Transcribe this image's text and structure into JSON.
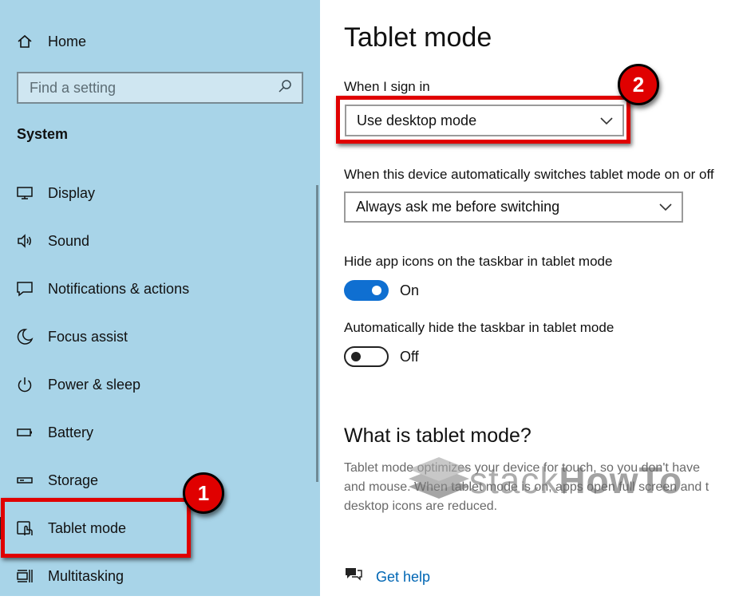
{
  "sidebar": {
    "home_label": "Home",
    "search_placeholder": "Find a setting",
    "section_title": "System",
    "items": [
      {
        "label": "Display",
        "icon": "monitor-icon"
      },
      {
        "label": "Sound",
        "icon": "speaker-icon"
      },
      {
        "label": "Notifications & actions",
        "icon": "message-icon"
      },
      {
        "label": "Focus assist",
        "icon": "moon-icon"
      },
      {
        "label": "Power & sleep",
        "icon": "power-icon"
      },
      {
        "label": "Battery",
        "icon": "battery-icon"
      },
      {
        "label": "Storage",
        "icon": "drive-icon"
      },
      {
        "label": "Tablet mode",
        "icon": "tablet-icon",
        "selected": true
      },
      {
        "label": "Multitasking",
        "icon": "multitasking-icon"
      }
    ]
  },
  "annotations": {
    "badge_1": "1",
    "badge_2": "2",
    "box_color": "#e00000"
  },
  "main": {
    "title": "Tablet mode",
    "sign_in_label": "When I sign in",
    "sign_in_value": "Use desktop mode",
    "switch_label": "When this device automatically switches tablet mode on or off",
    "switch_value": "Always ask me before switching",
    "hide_icons_label": "Hide app icons on the taskbar in tablet mode",
    "hide_icons_state": "On",
    "hide_taskbar_label": "Automatically hide the taskbar in tablet mode",
    "hide_taskbar_state": "Off",
    "what_title": "What is tablet mode?",
    "desc_lines": [
      "Tablet mode optimizes your device for touch, so you don't have",
      "and mouse. When tablet mode is on, apps open full screen and t",
      "desktop icons are reduced."
    ],
    "help_link": "Get help"
  },
  "watermark": {
    "part1": "stack",
    "part2": "HowTo"
  },
  "colors": {
    "sidebar_bg": "#a8d4e8",
    "toggle_on": "#0f6fd1",
    "link": "#0066b4"
  }
}
